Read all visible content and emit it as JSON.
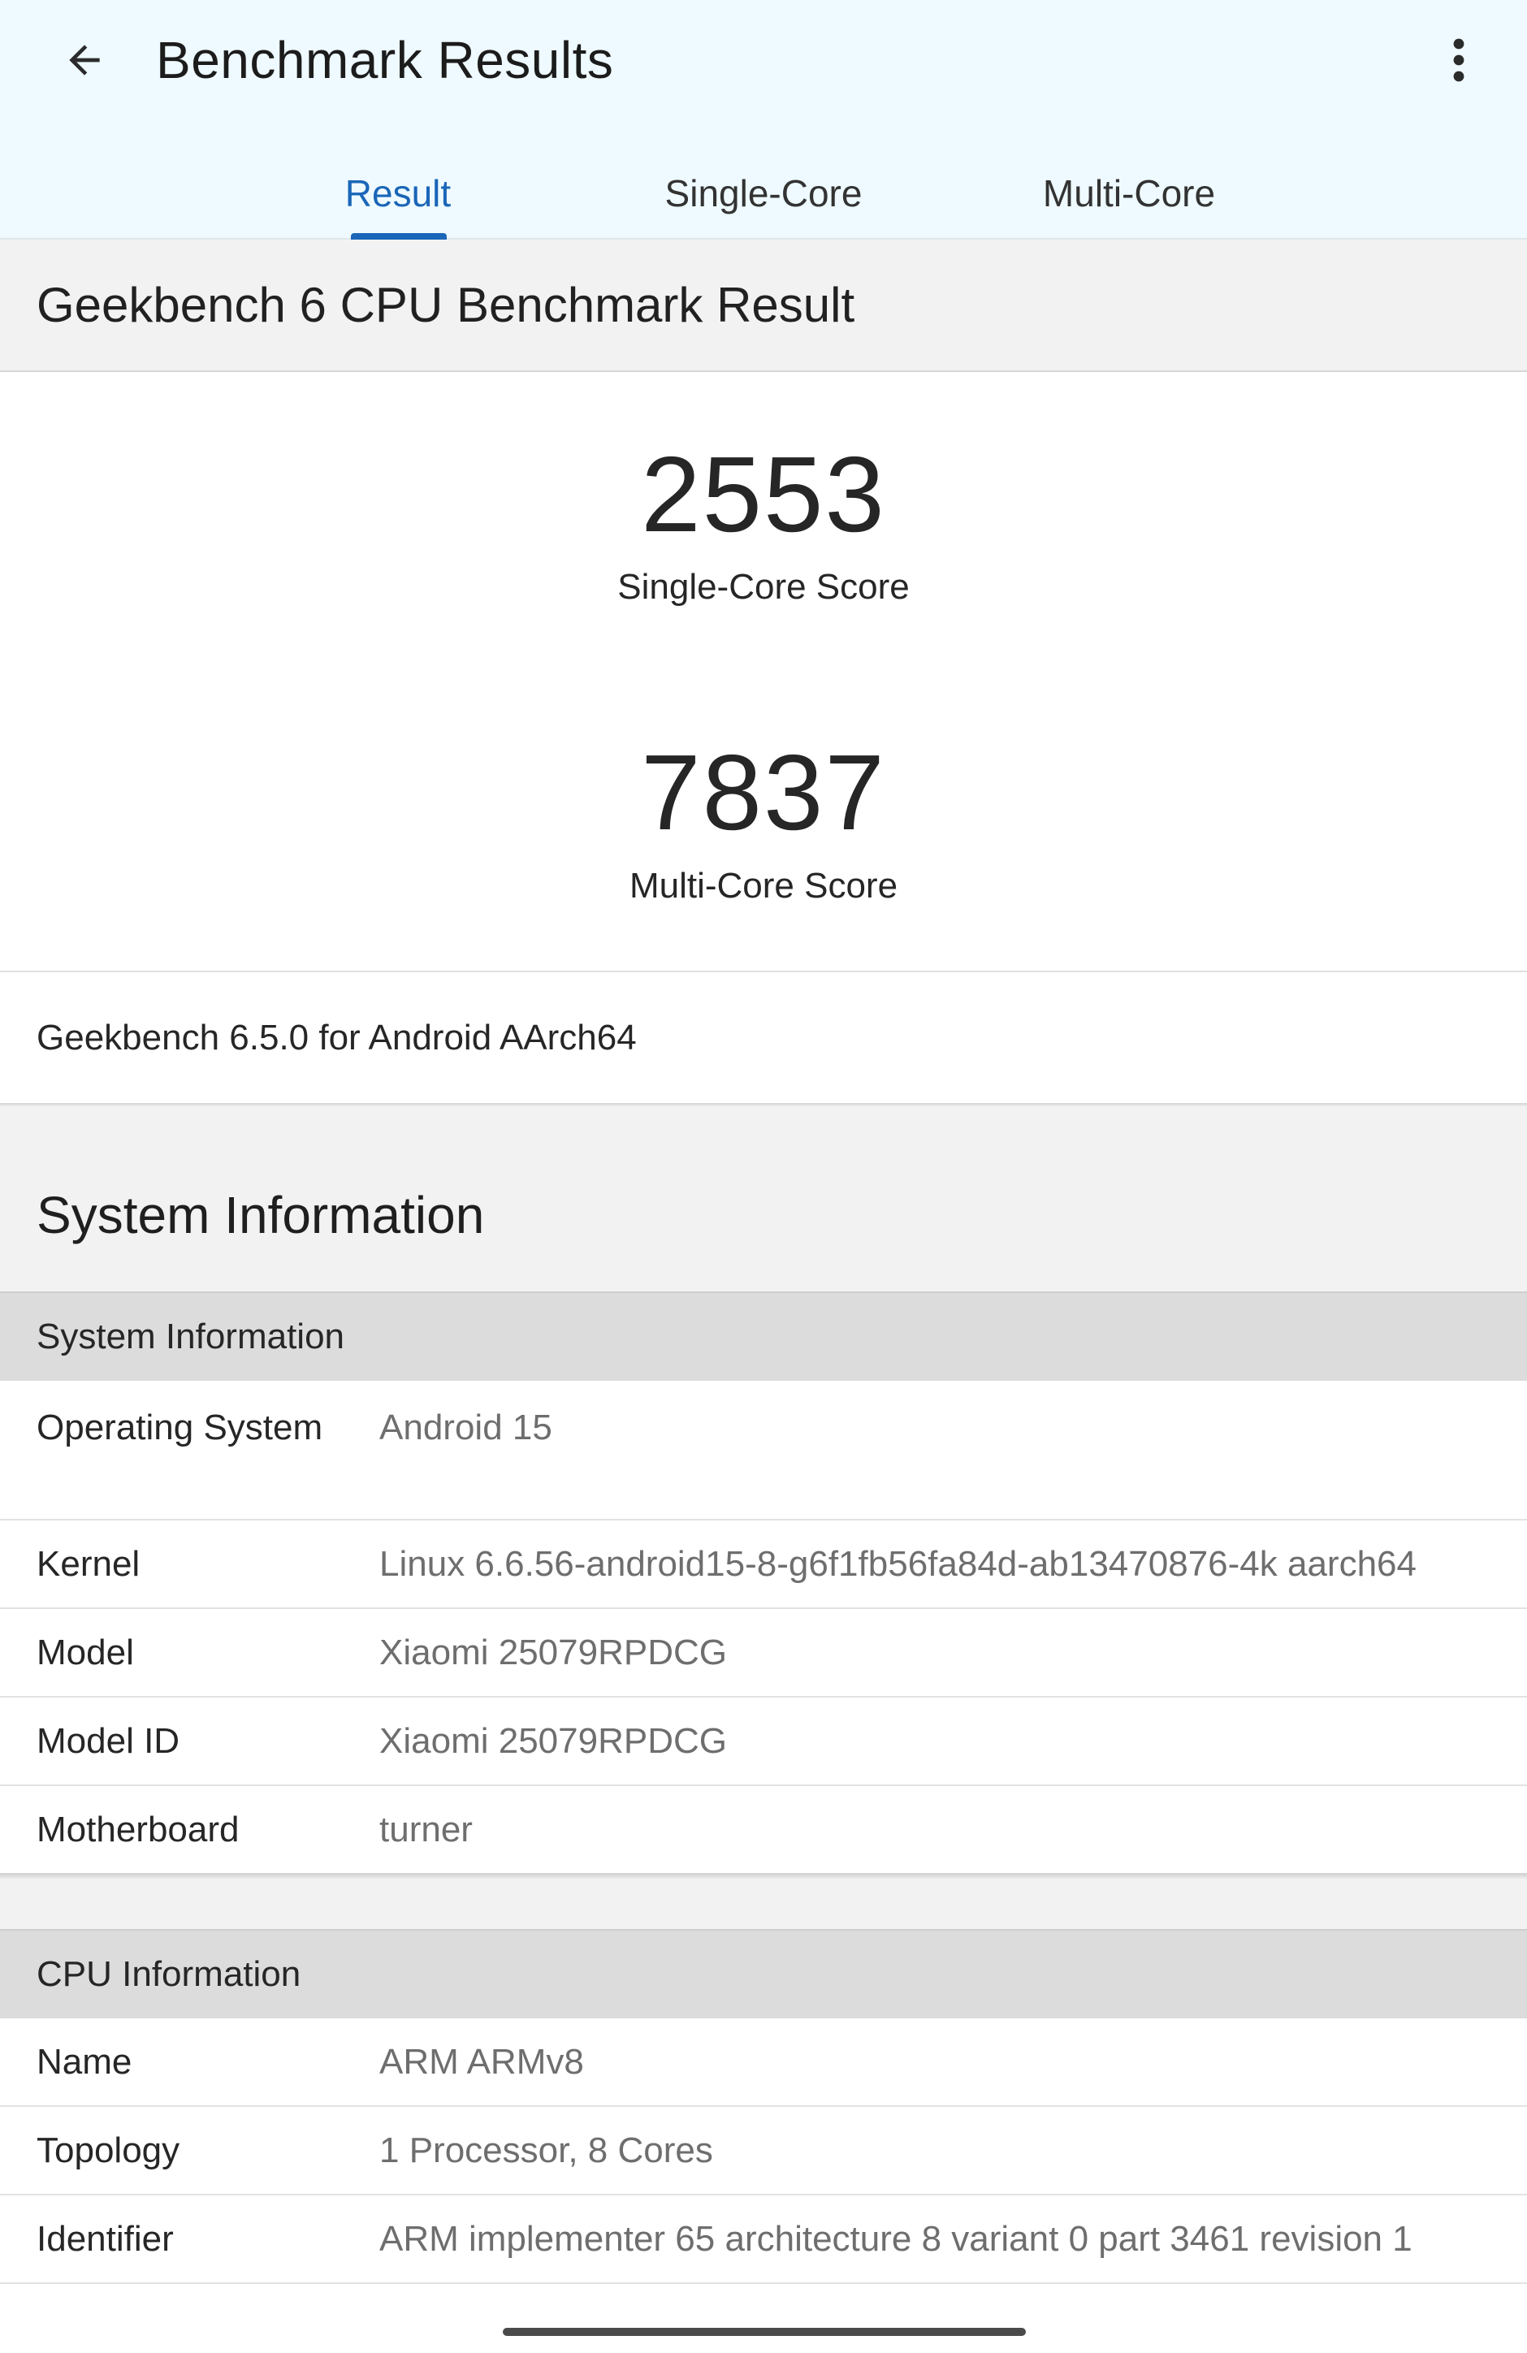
{
  "appbar": {
    "title": "Benchmark Results",
    "back_icon": "arrow-left-icon",
    "menu_icon": "more-vertical-icon"
  },
  "tabs": [
    {
      "label": "Result",
      "active": true
    },
    {
      "label": "Single-Core",
      "active": false
    },
    {
      "label": "Multi-Core",
      "active": false
    }
  ],
  "accent_color": "#1a66b8",
  "result": {
    "title": "Geekbench 6 CPU Benchmark Result",
    "single_core_score": "2553",
    "single_core_label": "Single-Core Score",
    "multi_core_score": "7837",
    "multi_core_label": "Multi-Core Score",
    "version": "Geekbench 6.5.0 for Android AArch64"
  },
  "system_information": {
    "heading": "System Information",
    "table_title": "System Information",
    "rows": [
      {
        "key": "Operating System",
        "value": "Android 15"
      },
      {
        "key": "Kernel",
        "value": "Linux 6.6.56-android15-8-g6f1fb56fa84d-ab13470876-4k aarch64"
      },
      {
        "key": "Model",
        "value": "Xiaomi 25079RPDCG"
      },
      {
        "key": "Model ID",
        "value": "Xiaomi 25079RPDCG"
      },
      {
        "key": "Motherboard",
        "value": "turner"
      }
    ]
  },
  "cpu_information": {
    "table_title": "CPU Information",
    "rows": [
      {
        "key": "Name",
        "value": "ARM ARMv8"
      },
      {
        "key": "Topology",
        "value": "1 Processor, 8 Cores"
      },
      {
        "key": "Identifier",
        "value": "ARM implementer 65 architecture 8 variant 0 part 3461 revision 1"
      }
    ]
  }
}
